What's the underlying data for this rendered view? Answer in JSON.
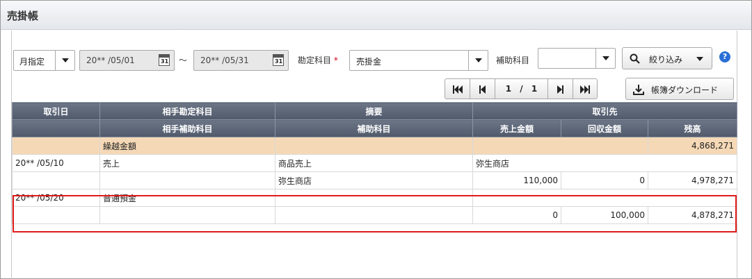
{
  "page": {
    "title": "売掛帳"
  },
  "filter": {
    "period_mode": "月指定",
    "date_from": "20** /05/01",
    "date_to": "20** /05/31",
    "tilde": "～",
    "calendar_icon_text": "31",
    "account_label": "勘定科目",
    "required_mark": "*",
    "account_value": "売掛金",
    "sub_account_label": "補助科目",
    "sub_account_value": "",
    "refine_label": "絞り込み",
    "help_symbol": "?"
  },
  "pager": {
    "current": "1",
    "separator": "/",
    "total": "1"
  },
  "download_label": "帳簿ダウンロード",
  "table": {
    "header_row1": [
      "取引日",
      "相手勘定科目",
      "摘要",
      "取引先"
    ],
    "header_row2": [
      "",
      "相手補助科目",
      "補助科目",
      "売上金額",
      "回収金額",
      "残高"
    ],
    "carry_forward": {
      "label": "繰越金額",
      "balance": "4,868,271"
    },
    "entries": [
      {
        "date": "20** /05/10",
        "account": "売上",
        "memo": "商品売上",
        "partner": "弥生商店",
        "sub_account": "",
        "sub_item": "弥生商店",
        "sales": "110,000",
        "collected": "0",
        "balance": "4,978,271"
      },
      {
        "date": "20** /05/20",
        "account": "普通預金",
        "memo": "",
        "partner": "",
        "sub_account": "",
        "sub_item": "",
        "sales": "0",
        "collected": "100,000",
        "balance": "4,878,271"
      }
    ]
  },
  "colors": {
    "header_bg": "#5a6476",
    "carry_bg": "#f5d9b7",
    "highlight": "#e01a1a",
    "help": "#2b6fd6"
  }
}
